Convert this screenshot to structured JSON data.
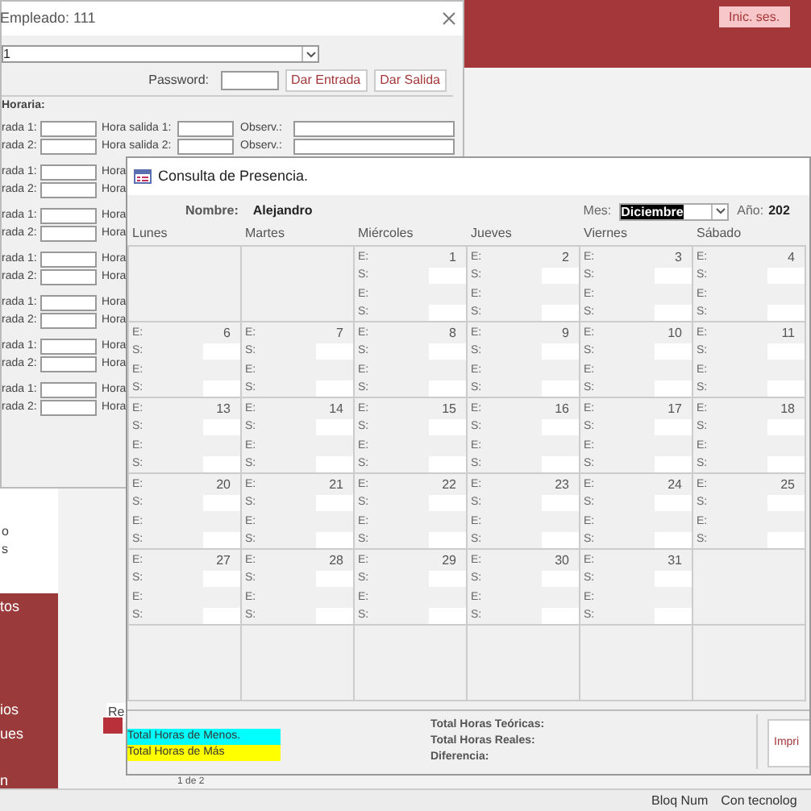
{
  "app": {
    "account_button": "Inic. ses.",
    "sidebar_fragments": [
      "o",
      "s"
    ],
    "nav_fragments": [
      "tos",
      "ios",
      "ues",
      "n"
    ],
    "behind": {
      "label": "Re",
      "record_counter": "1 de 2"
    },
    "status_bar": [
      "Bloq Num",
      "Con tecnolog"
    ]
  },
  "employee_window": {
    "title": "Empleado: 111",
    "employee_combo": "1",
    "password_label": "Password:",
    "buttons": [
      "Dar Entrada",
      "Dar Salida"
    ],
    "section": "Horaria:",
    "rows": [
      {
        "entry_label": "rada 1:",
        "exit_label": "Hora salida 1:",
        "obs_label": "Observ.:"
      },
      {
        "entry_label": "rada 2:",
        "exit_label": "Hora salida 2:",
        "obs_label": "Observ.:"
      },
      {
        "entry_label": "rada 1:",
        "exit_label": "Hora"
      },
      {
        "entry_label": "rada 2:",
        "exit_label": "Hora"
      },
      {
        "entry_label": "rada 1:",
        "exit_label": "Hora"
      },
      {
        "entry_label": "rada 2:",
        "exit_label": "Hora"
      },
      {
        "entry_label": "rada 1:",
        "exit_label": "Hora"
      },
      {
        "entry_label": "rada 2:",
        "exit_label": "Hora"
      },
      {
        "entry_label": "rada 1:",
        "exit_label": "Hora"
      },
      {
        "entry_label": "rada 2:",
        "exit_label": "Hora"
      },
      {
        "entry_label": "rada 1:",
        "exit_label": "Hora"
      },
      {
        "entry_label": "rada 2:",
        "exit_label": "Hora"
      },
      {
        "entry_label": "rada 1:",
        "exit_label": "Hora"
      },
      {
        "entry_label": "rada 2:",
        "exit_label": "Hora"
      }
    ]
  },
  "presence_window": {
    "title": "Consulta de Presencia.",
    "name_label": "Nombre:",
    "name": "Alejandro",
    "month_label": "Mes:",
    "month": "Diciembre",
    "year_label": "Año:",
    "year": "202",
    "weekdays": [
      "Lunes",
      "Martes",
      "Miércoles",
      "Jueves",
      "Viernes",
      "Sábado"
    ],
    "weeks": [
      [
        {
          "kind": "empty"
        },
        {
          "kind": "empty"
        },
        {
          "day": "1",
          "labels": [
            "E:",
            "S:",
            "E:",
            "S:"
          ]
        },
        {
          "day": "2",
          "labels": [
            "E:",
            "S:",
            "E:",
            "S:"
          ]
        },
        {
          "day": "3",
          "labels": [
            "E:",
            "S:",
            "E:",
            "S:"
          ]
        },
        {
          "day": "4",
          "labels": [
            "E:",
            "S:",
            "E:",
            "S:"
          ]
        }
      ],
      [
        {
          "day": "6",
          "labels": [
            "E:",
            "S:",
            "E:",
            "S:"
          ]
        },
        {
          "day": "7",
          "labels": [
            "E:",
            "S:",
            "E:",
            "S:"
          ]
        },
        {
          "day": "8",
          "labels": [
            "E:",
            "S:",
            "E:",
            "S:"
          ]
        },
        {
          "day": "9",
          "labels": [
            "E:",
            "S:",
            "E:",
            "S:"
          ]
        },
        {
          "day": "10",
          "labels": [
            "E:",
            "S:",
            "E:",
            "S:"
          ]
        },
        {
          "day": "11",
          "labels": [
            "E:",
            "S:",
            "E:",
            "S:"
          ]
        }
      ],
      [
        {
          "day": "13",
          "labels": [
            "E:",
            "S:",
            "E:",
            "S:"
          ]
        },
        {
          "day": "14",
          "labels": [
            "E:",
            "S:",
            "E:",
            "S:"
          ]
        },
        {
          "day": "15",
          "labels": [
            "E:",
            "S:",
            "E:",
            "S:"
          ]
        },
        {
          "day": "16",
          "labels": [
            "E:",
            "S:",
            "E:",
            "S:"
          ]
        },
        {
          "day": "17",
          "labels": [
            "E:",
            "S:",
            "E:",
            "S:"
          ]
        },
        {
          "day": "18",
          "labels": [
            "E:",
            "S:",
            "E:",
            "S:"
          ]
        }
      ],
      [
        {
          "day": "20",
          "labels": [
            "E:",
            "S:",
            "E:",
            "S:"
          ]
        },
        {
          "day": "21",
          "labels": [
            "E:",
            "S:",
            "E:",
            "S:"
          ]
        },
        {
          "day": "22",
          "labels": [
            "E:",
            "S:",
            "E:",
            "S:"
          ]
        },
        {
          "day": "23",
          "labels": [
            "E:",
            "S:",
            "E:",
            "S:"
          ]
        },
        {
          "day": "24",
          "labels": [
            "E:",
            "S:",
            "E:",
            "S:"
          ]
        },
        {
          "day": "25",
          "labels": [
            "E:",
            "S:",
            "E:",
            "S:"
          ]
        }
      ],
      [
        {
          "day": "27",
          "labels": [
            "E:",
            "S:",
            "E:",
            "S:"
          ]
        },
        {
          "day": "28",
          "labels": [
            "E:",
            "S:",
            "E:",
            "S:"
          ]
        },
        {
          "day": "29",
          "labels": [
            "E:",
            "S:",
            "E:",
            "S:"
          ]
        },
        {
          "day": "30",
          "labels": [
            "E:",
            "S:",
            "E:",
            "S:"
          ]
        },
        {
          "day": "31",
          "labels": [
            "E:",
            "S:",
            "E:",
            "S:"
          ]
        },
        {
          "kind": "empty"
        }
      ],
      [
        {
          "kind": "empty"
        },
        {
          "kind": "empty"
        },
        {
          "kind": "empty"
        },
        {
          "kind": "empty"
        },
        {
          "kind": "empty"
        },
        {
          "kind": "empty"
        }
      ]
    ],
    "legend": [
      {
        "label": "Total Horas de Menos.",
        "color": "#00ffff"
      },
      {
        "label": "Total Horas de Más",
        "color": "#ffff00"
      }
    ],
    "totals": [
      "Total Horas Teóricas:",
      "Total Horas Reales:",
      "Diferencia:"
    ],
    "print_button": "Impri"
  }
}
